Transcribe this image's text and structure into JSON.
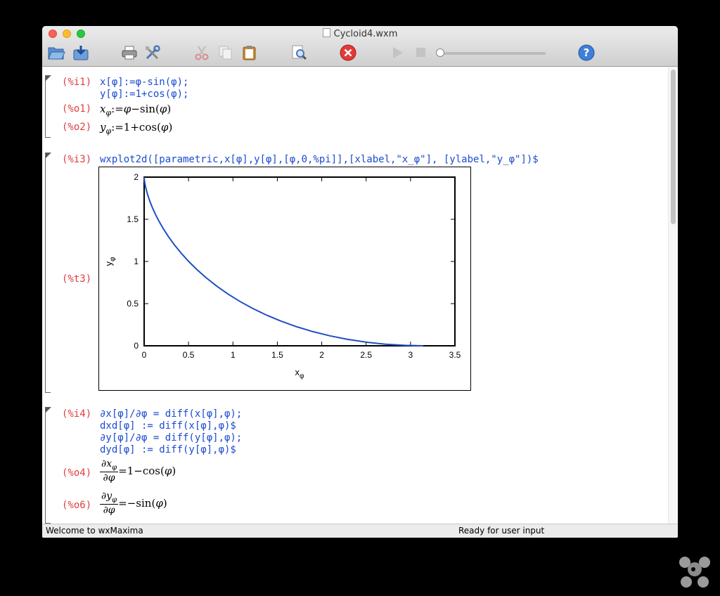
{
  "window": {
    "title": "Cycloid4.wxm"
  },
  "status": {
    "left": "Welcome to wxMaxima",
    "right": "Ready for user input"
  },
  "cells": {
    "i1": {
      "label": "(%i1)",
      "lines": [
        "x[φ]:=φ-sin(φ);",
        "y[φ]:=1+cos(φ);"
      ]
    },
    "o1": {
      "label": "(%o1)",
      "lhs": "x",
      "sub": "φ",
      "rhs_pre": ":=",
      "var": "φ",
      "rhs_op": "−sin",
      "arg": "φ"
    },
    "o2": {
      "label": "(%o2)",
      "lhs": "y",
      "sub": "φ",
      "rhs_pre": ":=1+cos",
      "arg": "φ"
    },
    "i3": {
      "label": "(%i3)",
      "line": "wxplot2d([parametric,x[φ],y[φ],[φ,0,%pi]],[xlabel,\"x_φ\"], [ylabel,\"y_φ\"])$"
    },
    "t3": {
      "label": "(%t3)"
    },
    "i4": {
      "label": "(%i4)",
      "lines": [
        "∂x[φ]/∂φ = diff(x[φ],φ);",
        "dxd[φ] := diff(x[φ],φ)$",
        "∂y[φ]/∂φ = diff(y[φ],φ);",
        "dyd[φ] := diff(y[φ],φ)$"
      ]
    },
    "o4": {
      "label": "(%o4)",
      "num": "∂x",
      "sub": "φ",
      "den": "∂φ",
      "rhs": "=1−cos",
      "arg": "φ"
    },
    "o6": {
      "label": "(%o6)",
      "num": "∂y",
      "sub": "φ",
      "den": "∂φ",
      "rhs": "=−sin",
      "arg": "φ"
    }
  },
  "chart_data": {
    "type": "line",
    "xlabel": "x_φ",
    "ylabel": "y_φ",
    "xlim": [
      0,
      3.5
    ],
    "ylim": [
      0,
      2
    ],
    "x_ticks": [
      "0",
      "0.5",
      "1",
      "1.5",
      "2",
      "2.5",
      "3",
      "3.5"
    ],
    "y_ticks": [
      "0",
      "0.5",
      "1",
      "1.5",
      "2"
    ],
    "line_color": "#1f4fc4",
    "series": [
      {
        "x": [
          0,
          0.0001,
          0.0011,
          0.0036,
          0.0086,
          0.0166,
          0.0285,
          0.0449,
          0.0667,
          0.0943,
          0.1286,
          0.17,
          0.2192,
          0.2765,
          0.3424,
          0.4174,
          0.5019,
          0.5961,
          0.7002,
          0.8146,
          0.9392,
          1.0741,
          1.2192,
          1.3745,
          1.5397,
          1.7145,
          1.8986,
          2.0915,
          2.2927,
          2.5016,
          2.7174,
          2.9396,
          3.1416
        ],
        "y": [
          2,
          1.9952,
          1.9808,
          1.9569,
          1.9239,
          1.8819,
          1.8315,
          1.773,
          1.7071,
          1.6344,
          1.5556,
          1.4714,
          1.3827,
          1.2903,
          1.1951,
          1.0981,
          1.0,
          0.9019,
          0.8049,
          0.7097,
          0.6173,
          0.5286,
          0.4444,
          0.3656,
          0.2929,
          0.227,
          0.1685,
          0.1181,
          0.0761,
          0.0431,
          0.0192,
          0.0048,
          0
        ]
      }
    ]
  }
}
